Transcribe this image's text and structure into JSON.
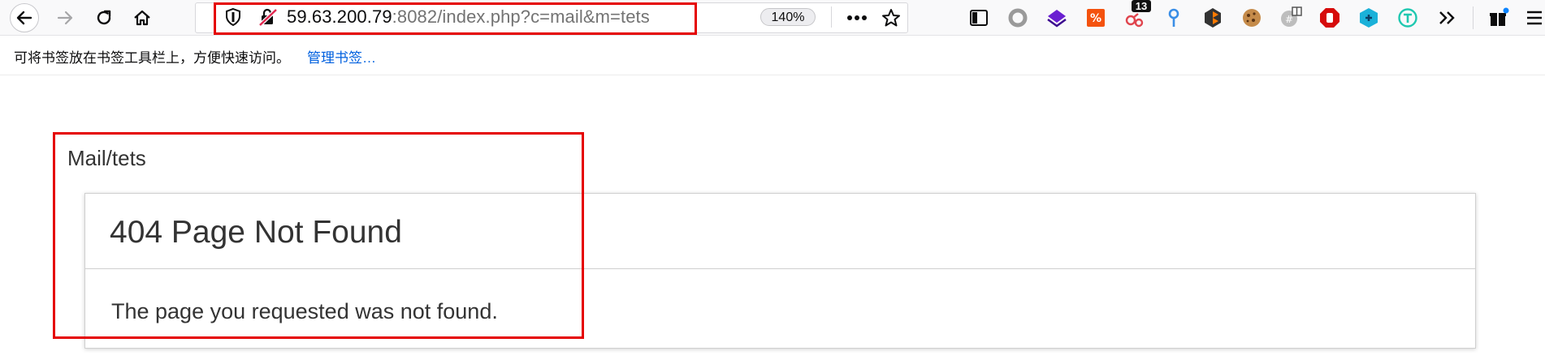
{
  "browser": {
    "url_host": "59.63.200.79",
    "url_rest": ":8082/index.php?c=mail&m=tets",
    "zoom": "140%",
    "extension_badge_count": "13",
    "colors": {
      "highlight": "#e50000",
      "link": "#0060df"
    }
  },
  "bookmarks_bar": {
    "message": "可将书签放在书签工具栏上，方便快速访问。",
    "manage_link": "管理书签…"
  },
  "page": {
    "breadcrumb": "Mail/tets",
    "panel_title": "404 Page Not Found",
    "panel_body": "The page you requested was not found."
  }
}
